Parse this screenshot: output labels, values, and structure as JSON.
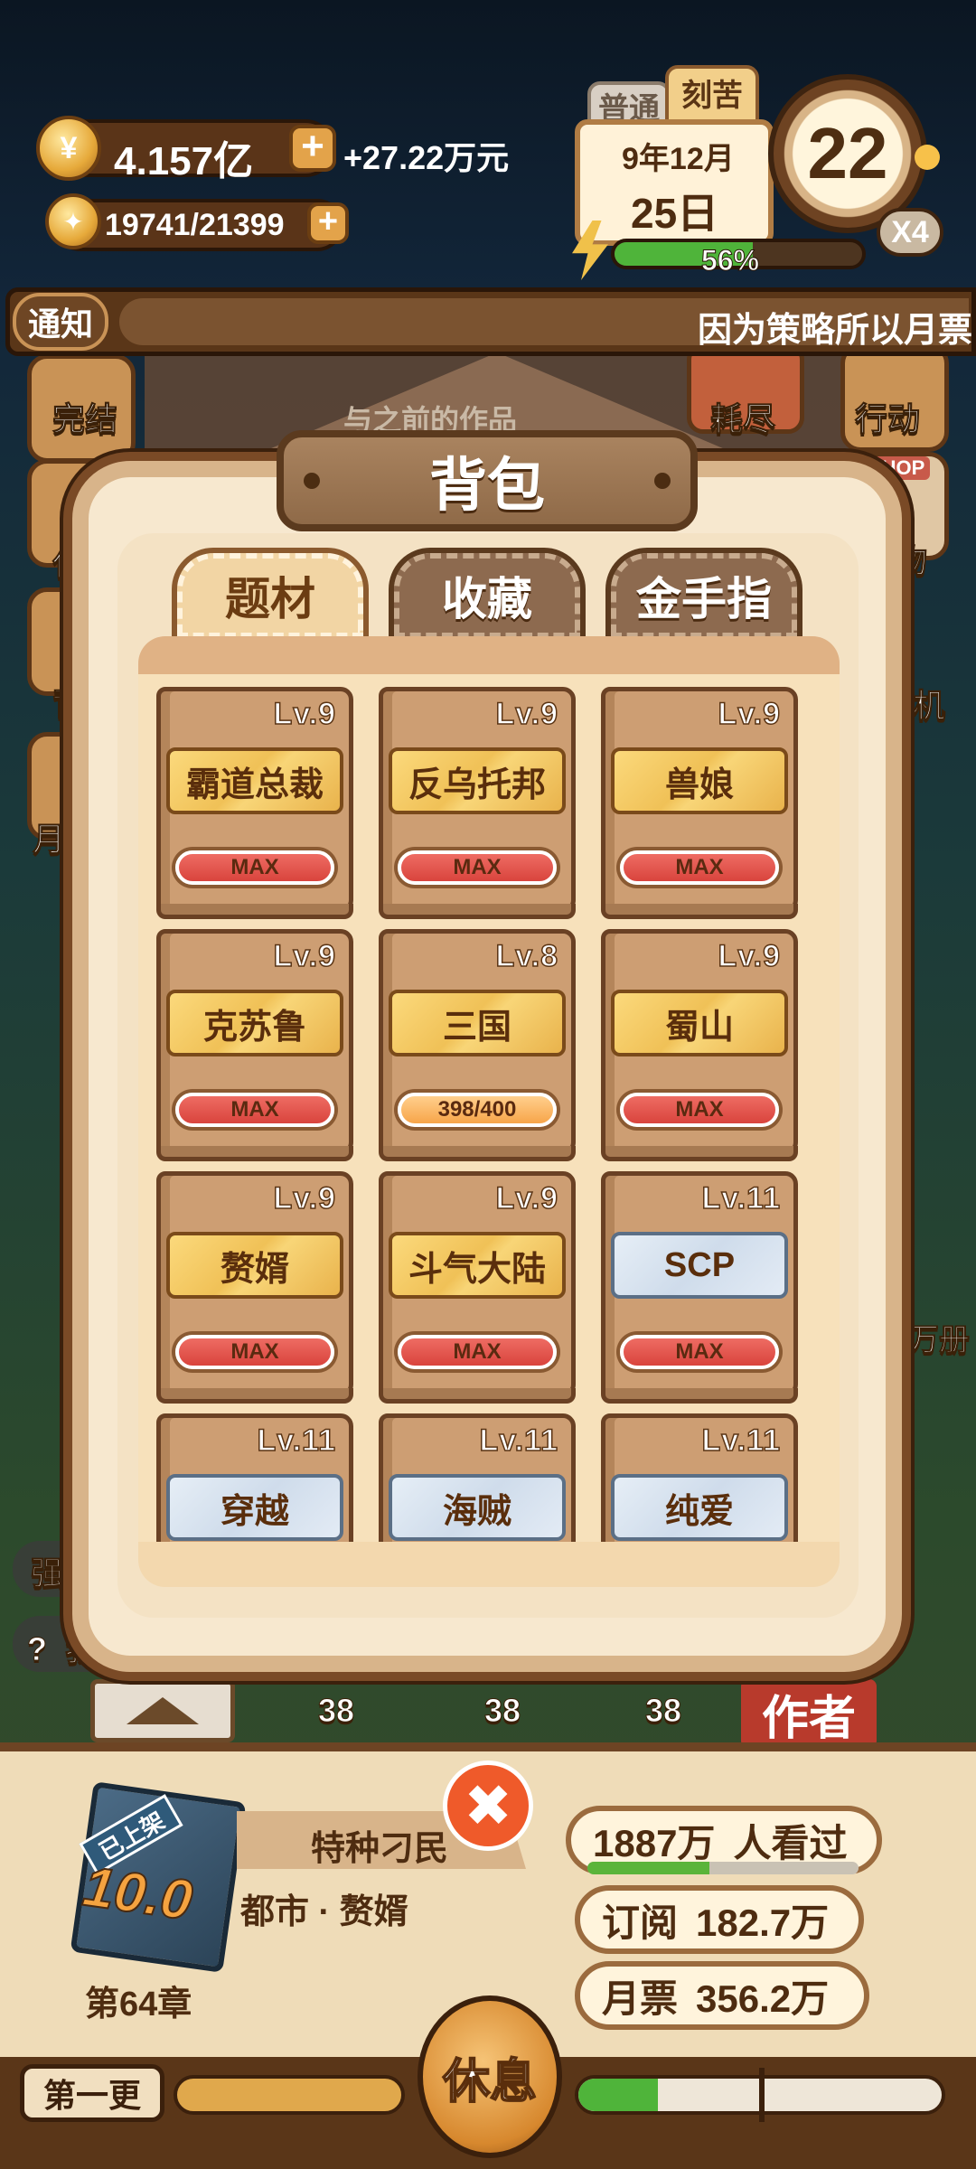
{
  "hud": {
    "money": "4.157亿",
    "income": "+27.22万元",
    "energy": "19741/21399",
    "mode_normal": "普通",
    "mode_hard": "刻苦",
    "date_year_month": "9年12月",
    "date_day": "25日",
    "clock_value": "22",
    "speed": "X4",
    "progress_label": "56%",
    "progress_value": 0.56
  },
  "notice": {
    "label": "通知",
    "text": "因为策略所以月票"
  },
  "background": {
    "left_labels": [
      "完结",
      "任",
      "背",
      "月"
    ],
    "center_labels": [
      "耗尽"
    ],
    "right_labels": [
      "行动",
      "物",
      "机"
    ],
    "shop_sign": "SHOP",
    "faded_text": "与之前的作品",
    "right_side_text": "万册",
    "left_side_texts": [
      "强",
      "?  我"
    ],
    "row_counts": [
      "38",
      "38",
      "38"
    ],
    "author_label": "作者"
  },
  "modal": {
    "title": "背包",
    "tabs": [
      {
        "label": "题材",
        "active": true
      },
      {
        "label": "收藏",
        "active": false
      },
      {
        "label": "金手指",
        "active": false
      }
    ],
    "items": [
      {
        "level": "Lv.9",
        "name": "霸道总裁",
        "status": "MAX",
        "style": "gold",
        "bar": "red"
      },
      {
        "level": "Lv.9",
        "name": "反乌托邦",
        "status": "MAX",
        "style": "gold",
        "bar": "red"
      },
      {
        "level": "Lv.9",
        "name": "兽娘",
        "status": "MAX",
        "style": "gold",
        "bar": "red"
      },
      {
        "level": "Lv.9",
        "name": "克苏鲁",
        "status": "MAX",
        "style": "gold",
        "bar": "red"
      },
      {
        "level": "Lv.8",
        "name": "三国",
        "status": "398/400",
        "style": "gold",
        "bar": "orange"
      },
      {
        "level": "Lv.9",
        "name": "蜀山",
        "status": "MAX",
        "style": "gold",
        "bar": "red"
      },
      {
        "level": "Lv.9",
        "name": "赘婿",
        "status": "MAX",
        "style": "gold",
        "bar": "red"
      },
      {
        "level": "Lv.9",
        "name": "斗气大陆",
        "status": "MAX",
        "style": "gold",
        "bar": "red"
      },
      {
        "level": "Lv.11",
        "name": "SCP",
        "status": "MAX",
        "style": "blue",
        "bar": "red"
      },
      {
        "level": "Lv.11",
        "name": "穿越",
        "status": "",
        "style": "blue",
        "bar": "red"
      },
      {
        "level": "Lv.11",
        "name": "海贼",
        "status": "",
        "style": "blue",
        "bar": "red"
      },
      {
        "level": "Lv.11",
        "name": "纯爱",
        "status": "",
        "style": "blue",
        "bar": "red"
      }
    ]
  },
  "bottom": {
    "book_badge": "已上架",
    "book_score": "10.0",
    "chapter": "第64章",
    "book_title": "特种刁民",
    "book_genre": "都市 · 赘婿",
    "views_value": "1887万",
    "views_label": "人看过",
    "subs_label": "订阅",
    "subs_value": "182.7万",
    "tickets_label": "月票",
    "tickets_value": "356.2万",
    "update_label": "第一更",
    "rest_button": "休息"
  },
  "colors": {
    "gold_item": "#f0c157",
    "blue_item": "#cfdceb",
    "max_bar": "#d9443d",
    "progress_bar": "#f7a549",
    "frame_brown": "#7a4a26"
  }
}
